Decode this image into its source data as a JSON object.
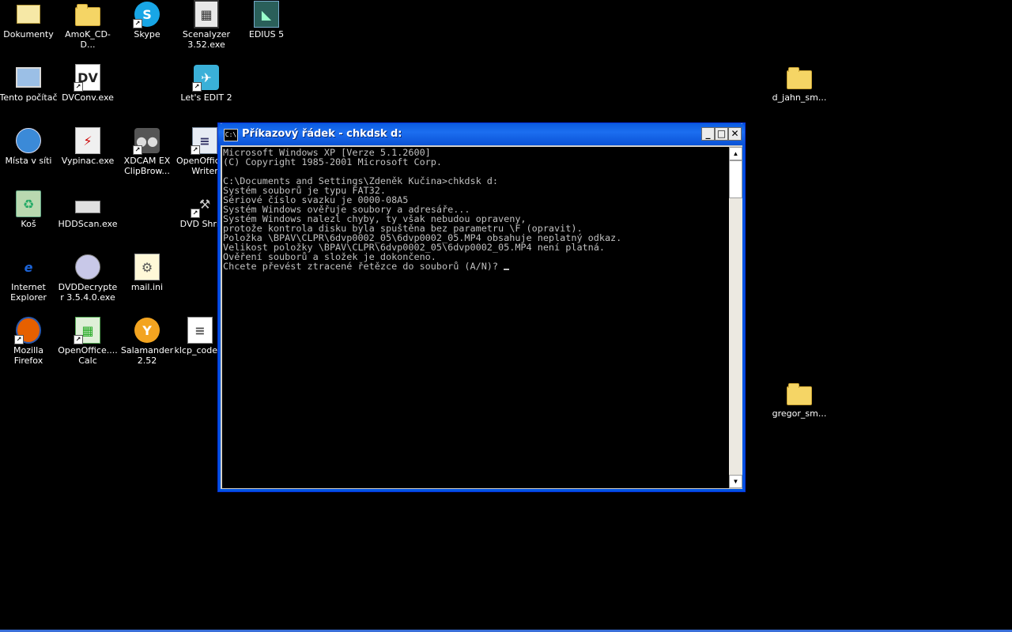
{
  "desktop": {
    "icons": [
      {
        "label": "Dokumenty",
        "icon": "documents-icon"
      },
      {
        "label": "AmoK_CD-D...",
        "icon": "folder-icon"
      },
      {
        "label": "Skype",
        "icon": "skype-icon"
      },
      {
        "label": "Scenalyzer 3.52.exe",
        "icon": "film-icon"
      },
      {
        "label": "EDIUS 5",
        "icon": "edius-icon"
      },
      {
        "label": "Tento počítač",
        "icon": "computer-icon"
      },
      {
        "label": "DVConv.exe",
        "icon": "dv-icon"
      },
      {
        "label": "Let's EDIT 2",
        "icon": "letsedit-icon"
      },
      {
        "label": "d_jahn_sm...",
        "icon": "folder-icon"
      },
      {
        "label": "Místa v síti",
        "icon": "network-icon"
      },
      {
        "label": "Vypinac.exe",
        "icon": "monitor-icon"
      },
      {
        "label": "XDCAM EX ClipBrow...",
        "icon": "xdcam-icon"
      },
      {
        "label": "OpenOffice... Writer",
        "icon": "writer-icon"
      },
      {
        "label": "Koš",
        "icon": "recycle-bin-icon"
      },
      {
        "label": "HDDScan.exe",
        "icon": "hdd-icon"
      },
      {
        "label": "DVD Shrink",
        "icon": "dvd-shrink-icon"
      },
      {
        "label": "Internet Explorer",
        "icon": "internet-explorer-icon"
      },
      {
        "label": "DVDDecrypter 3.5.4.0.exe",
        "icon": "dvd-icon"
      },
      {
        "label": "mail.ini",
        "icon": "ini-file-icon"
      },
      {
        "label": "Mozilla Firefox",
        "icon": "firefox-icon"
      },
      {
        "label": "OpenOffice.... Calc",
        "icon": "calc-icon"
      },
      {
        "label": "Salamander 2.52",
        "icon": "salamander-icon"
      },
      {
        "label": "klcp_code...",
        "icon": "text-file-icon"
      },
      {
        "label": "gregor_sm...",
        "icon": "folder-icon"
      }
    ]
  },
  "window": {
    "title": "Příkazový řádek - chkdsk d:",
    "icon_text": "C:\\",
    "minimize_label": "_",
    "maximize_label": "□",
    "close_label": "✕"
  },
  "console": {
    "lines": "Microsoft Windows XP [Verze 5.1.2600]\n(C) Copyright 1985-2001 Microsoft Corp.\n\nC:\\Documents and Settings\\Zdeněk Kučina>chkdsk d:\nSystém souborů je typu FAT32.\nSériové číslo svazku je 0000-08A5\nSystém Windows ověřuje soubory a adresáře...\nSystém Windows nalezl chyby, ty však nebudou opraveny,\nprotože kontrola disku byla spuštěna bez parametru \\F (opravit).\nPoložka \\BPAV\\CLPR\\6dvp0002_05\\6dvp0002_05.MP4 obsahuje neplatný odkaz.\nVelikost položky \\BPAV\\CLPR\\6dvp0002_05\\6dvp0002_05.MP4 není platná.\nOvěření souborů a složek je dokončeno.\nChcete převést ztracené řetězce do souborů (A/N)? "
  },
  "colors": {
    "desktop_background": "#000000",
    "titlebar": "#0a5be0",
    "console_text": "#c0c0c0"
  }
}
